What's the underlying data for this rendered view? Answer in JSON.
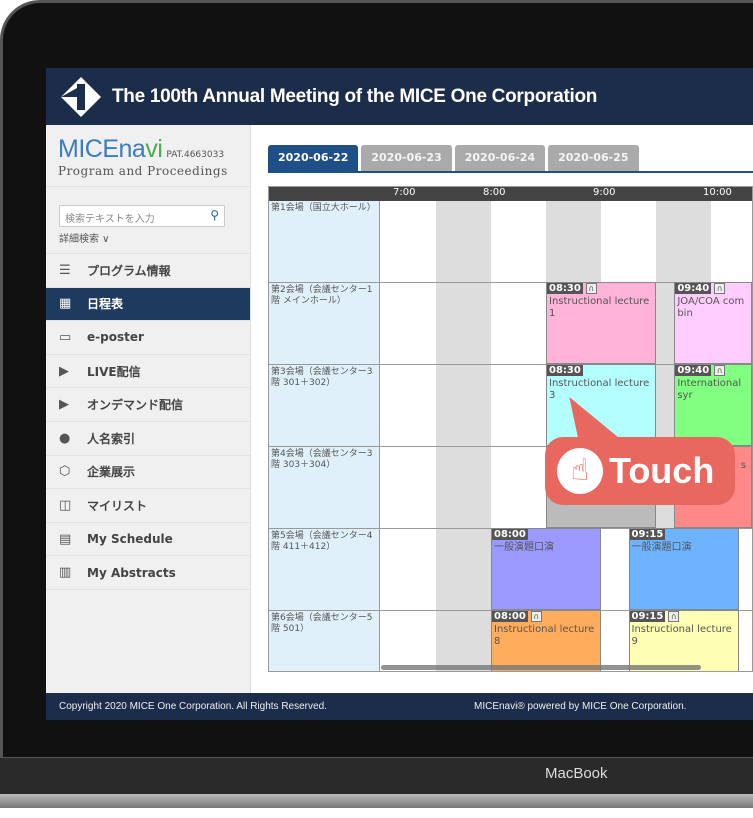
{
  "header": {
    "title": "The 100th Annual Meeting of the MICE One Corporation"
  },
  "sidebar": {
    "logo_main": "MICEna",
    "logo_i": "vi",
    "patent": "PAT.4663033",
    "subtitle": "Program and Proceedings",
    "search_placeholder": "検索テキストを入力",
    "advanced_search": "詳細検索 ∨",
    "items": [
      {
        "label": "プログラム情報",
        "icon": "list-icon",
        "glyph": "☰"
      },
      {
        "label": "日程表",
        "icon": "calendar-icon",
        "glyph": "▦",
        "active": true
      },
      {
        "label": "e-poster",
        "icon": "monitor-icon",
        "glyph": "▭"
      },
      {
        "label": "LIVE配信",
        "icon": "play-icon",
        "glyph": "▶"
      },
      {
        "label": "オンデマンド配信",
        "icon": "play-icon",
        "glyph": "▶"
      },
      {
        "label": "人名索引",
        "icon": "person-icon",
        "glyph": "●"
      },
      {
        "label": "企業展示",
        "icon": "cube-icon",
        "glyph": "⬡"
      },
      {
        "label": "マイリスト",
        "icon": "book-icon",
        "glyph": "◫"
      },
      {
        "label": "My Schedule",
        "icon": "schedule-icon",
        "glyph": "▤"
      },
      {
        "label": "My Abstracts",
        "icon": "books-icon",
        "glyph": "▥"
      }
    ]
  },
  "tabs": [
    "2020-06-22",
    "2020-06-23",
    "2020-06-24",
    "2020-06-25"
  ],
  "active_tab": 0,
  "schedule": {
    "hours": [
      "7:00",
      "8:00",
      "9:00",
      "10:00"
    ],
    "rooms": [
      {
        "name": "第1会場（国立大ホール）",
        "sessions": []
      },
      {
        "name": "第2会場（会議センター1階 メインホール）",
        "sessions": [
          {
            "start": "08:30",
            "end": "09:30",
            "title": "Instructional lecture 1",
            "audio": true,
            "color": "#ffb3d9"
          },
          {
            "start": "09:40",
            "end": "10:45",
            "title": "JOA/COA combin",
            "audio": true,
            "color": "#ffccff"
          }
        ]
      },
      {
        "name": "第3会場（会議センター3階 301＋302）",
        "sessions": [
          {
            "start": "08:30",
            "end": "09:30",
            "title": "Instructional lecture 3",
            "audio": false,
            "color": "#b3ffff"
          },
          {
            "start": "09:40",
            "end": "10:45",
            "title": "International syr",
            "audio": true,
            "color": "#80ff80"
          }
        ]
      },
      {
        "name": "第4会場（会議センター3階 303＋304）",
        "sessions": [
          {
            "start": "08:30",
            "end": "09:30",
            "title": "",
            "audio": false,
            "color": "#bbbbbb"
          },
          {
            "start": "09:40",
            "end": "10:45",
            "title": "                    syr",
            "audio": false,
            "color": "#ff8888"
          }
        ]
      },
      {
        "name": "第5会場（会議センター4階 411＋412）",
        "sessions": [
          {
            "start": "08:00",
            "end": "09:00",
            "title": "一般演題口演",
            "audio": false,
            "color": "#9999ff"
          },
          {
            "start": "09:15",
            "end": "10:15",
            "title": "一般演題口演",
            "audio": false,
            "color": "#6db3ff"
          }
        ]
      },
      {
        "name": "第6会場（会議センター5階 501）",
        "sessions": [
          {
            "start": "08:00",
            "end": "09:00",
            "title": "Instructional lecture 8",
            "audio": true,
            "color": "#ffad5c"
          },
          {
            "start": "09:15",
            "end": "10:15",
            "title": "Instructional lecture 9",
            "audio": true,
            "color": "#ffffb3"
          }
        ]
      }
    ]
  },
  "touch_label": "Touch",
  "footer": {
    "copyright": "Copyright 2020 MICE One Corporation. All Rights Reserved.",
    "powered": "MICEnavi® powered by MICE One Corporation."
  },
  "device_label": "MacBook"
}
